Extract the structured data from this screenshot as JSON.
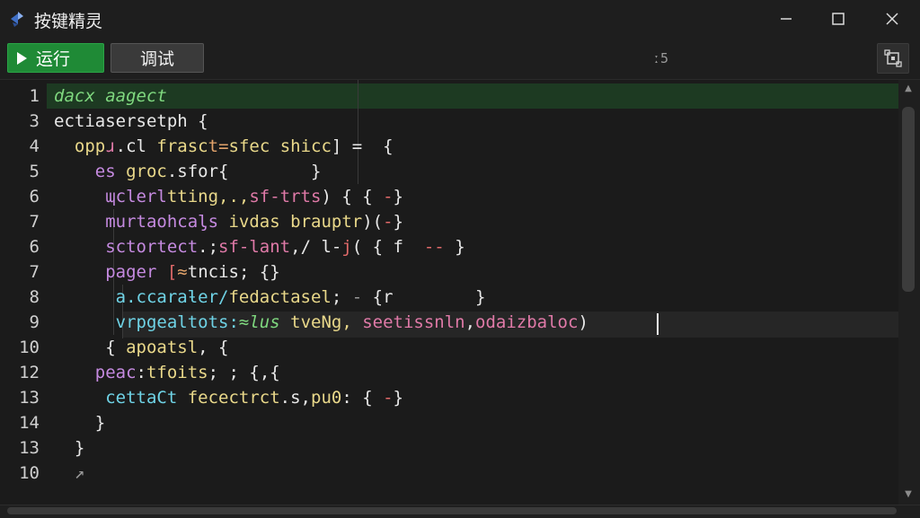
{
  "window": {
    "title": "按键精灵",
    "icon": "app-logo-icon"
  },
  "toolbar": {
    "run_label": "运行",
    "debug_label": "调试",
    "counter": "ː5",
    "tool_icon": "screenshot-icon"
  },
  "editor": {
    "line_numbers": [
      "1",
      "3",
      "4",
      "5",
      "6",
      "7",
      "6",
      "7",
      "8",
      "9",
      "10",
      "12",
      "13",
      "14",
      "13",
      "10"
    ],
    "lines": [
      [
        {
          "t": "dacx aagect",
          "c": "c-green"
        }
      ],
      [
        {
          "t": "ectiasersetph {",
          "c": "c-white"
        }
      ],
      [
        {
          "t": "  opp",
          "c": "c-yellow"
        },
        {
          "t": "ɹ",
          "c": "c-pink"
        },
        {
          "t": ".cl ",
          "c": "c-white"
        },
        {
          "t": "frasc",
          "c": "c-yellow"
        },
        {
          "t": "t=",
          "c": "c-orange"
        },
        {
          "t": "sfec ",
          "c": "c-yellow"
        },
        {
          "t": "shicc",
          "c": "c-yellow"
        },
        {
          "t": "] =  {",
          "c": "c-white"
        }
      ],
      [
        {
          "t": "    es ",
          "c": "c-purple"
        },
        {
          "t": "groc",
          "c": "c-yellow"
        },
        {
          "t": ".sfor{        }",
          "c": "c-white"
        }
      ],
      [
        {
          "t": "     ",
          "c": "c-white"
        },
        {
          "t": "ɰclerl",
          "c": "c-purple"
        },
        {
          "t": "tting,.,",
          "c": "c-yellow"
        },
        {
          "t": "sf-trts",
          "c": "c-pink"
        },
        {
          "t": ") { { ",
          "c": "c-white"
        },
        {
          "t": "-",
          "c": "c-red"
        },
        {
          "t": "}",
          "c": "c-white"
        }
      ],
      [
        {
          "t": "     ",
          "c": "c-white"
        },
        {
          "t": "murtaohcaᶅs ",
          "c": "c-purple"
        },
        {
          "t": "ivdas ",
          "c": "c-yellow"
        },
        {
          "t": "brauptr",
          "c": "c-yellow"
        },
        {
          "t": ")(",
          "c": "c-white"
        },
        {
          "t": "-",
          "c": "c-red"
        },
        {
          "t": "}",
          "c": "c-white"
        }
      ],
      [
        {
          "t": "     ",
          "c": "c-white"
        },
        {
          "t": "sctortect",
          "c": "c-purple"
        },
        {
          "t": ".;",
          "c": "c-white"
        },
        {
          "t": "sf-lant",
          "c": "c-pink"
        },
        {
          "t": ",/ l-",
          "c": "c-white"
        },
        {
          "t": "j",
          "c": "c-red"
        },
        {
          "t": "( { f  ",
          "c": "c-white"
        },
        {
          "t": "--",
          "c": "c-red"
        },
        {
          "t": " }",
          "c": "c-white"
        }
      ],
      [
        {
          "t": "     ",
          "c": "c-white"
        },
        {
          "t": "pager ",
          "c": "c-purple"
        },
        {
          "t": "[",
          "c": "c-red"
        },
        {
          "t": "≈",
          "c": "c-orange"
        },
        {
          "t": "tncis; {}",
          "c": "c-white"
        }
      ],
      [
        {
          "t": "      ",
          "c": "c-white"
        },
        {
          "t": "a.ccaraƚer/",
          "c": "c-cyan"
        },
        {
          "t": "fedactasel",
          "c": "c-yellow"
        },
        {
          "t": "; ",
          "c": "c-white"
        },
        {
          "t": "- ",
          "c": "c-gray"
        },
        {
          "t": "{r        }",
          "c": "c-white"
        }
      ],
      [
        {
          "t": "      ",
          "c": "c-white"
        },
        {
          "t": "vrpgealtots:",
          "c": "c-cyan"
        },
        {
          "t": "≈lus ",
          "c": "c-green"
        },
        {
          "t": "tveNg, ",
          "c": "c-yellow"
        },
        {
          "t": "seetissnln",
          "c": "c-pink"
        },
        {
          "t": ",",
          "c": "c-white"
        },
        {
          "t": "odaizbaloc",
          "c": "c-pink"
        },
        {
          "t": ")",
          "c": "c-white"
        }
      ],
      [
        {
          "t": "     { ",
          "c": "c-white"
        },
        {
          "t": "apoatsl",
          "c": "c-yellow"
        },
        {
          "t": ", {",
          "c": "c-white"
        }
      ],
      [
        {
          "t": "    ",
          "c": "c-white"
        },
        {
          "t": "peac",
          "c": "c-purple"
        },
        {
          "t": ":",
          "c": "c-white"
        },
        {
          "t": "tfoits",
          "c": "c-yellow"
        },
        {
          "t": "; ; {,{",
          "c": "c-white"
        }
      ],
      [
        {
          "t": "     ",
          "c": "c-white"
        },
        {
          "t": "cettaCt ",
          "c": "c-cyan"
        },
        {
          "t": "fecectrct",
          "c": "c-yellow"
        },
        {
          "t": ".s,",
          "c": "c-white"
        },
        {
          "t": "pu0",
          "c": "c-yellow"
        },
        {
          "t": ": { ",
          "c": "c-white"
        },
        {
          "t": "-",
          "c": "c-red"
        },
        {
          "t": "}",
          "c": "c-white"
        }
      ],
      [
        {
          "t": "    }",
          "c": "c-white"
        }
      ],
      [
        {
          "t": "  }",
          "c": "c-white"
        }
      ],
      [
        {
          "t": "  ↗",
          "c": "c-gray"
        }
      ]
    ]
  }
}
